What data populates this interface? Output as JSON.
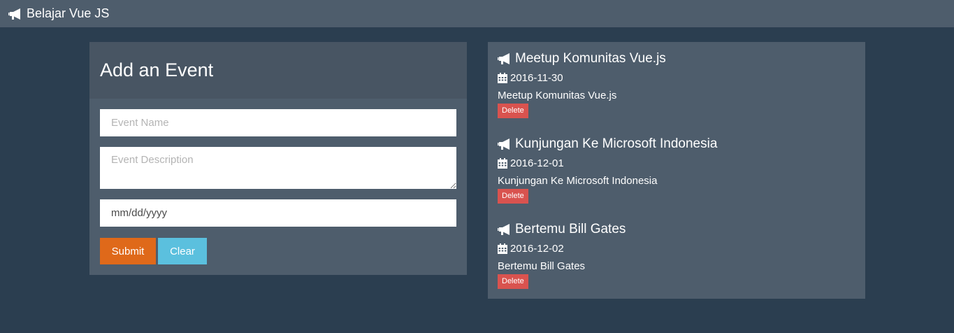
{
  "navbar": {
    "brand_icon": "bullhorn-icon",
    "brand_label": "Belajar Vue JS"
  },
  "form": {
    "heading": "Add an Event",
    "name_placeholder": "Event Name",
    "desc_placeholder": "Event Description",
    "date_value": "mm/dd/yyyy",
    "submit_label": "Submit",
    "clear_label": "Clear"
  },
  "events": [
    {
      "title": "Meetup Komunitas Vue.js",
      "date": "2016-11-30",
      "description": "Meetup Komunitas Vue.js",
      "delete_label": "Delete"
    },
    {
      "title": "Kunjungan Ke Microsoft Indonesia",
      "date": "2016-12-01",
      "description": "Kunjungan Ke Microsoft Indonesia",
      "delete_label": "Delete"
    },
    {
      "title": "Bertemu Bill Gates",
      "date": "2016-12-02",
      "description": "Bertemu Bill Gates",
      "delete_label": "Delete"
    }
  ],
  "colors": {
    "background": "#2b3e50",
    "panel": "#4e5d6c",
    "submit": "#df691a",
    "clear": "#5bc0de",
    "delete": "#d9534f"
  }
}
